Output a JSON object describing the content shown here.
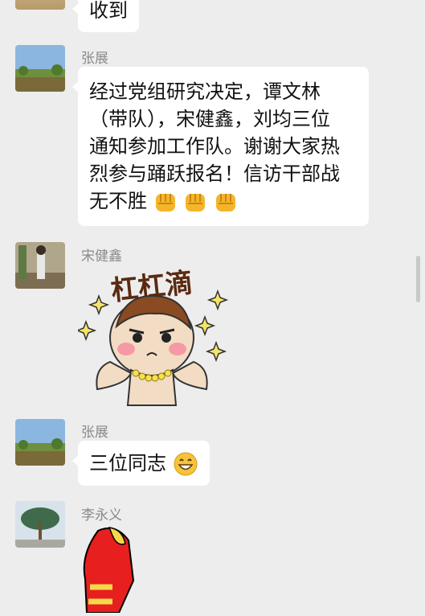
{
  "messages": [
    {
      "sender": "",
      "text": "收到"
    },
    {
      "sender": "张展",
      "lines": [
        "经过党组研究决定，谭文林",
        "（带队），宋健鑫，刘均三位",
        "通知参加工作队。谢谢大家热",
        "烈参与踊跃报名！信访干部战",
        "无不胜"
      ],
      "emoji": "fist-emoji"
    },
    {
      "sender": "宋健鑫",
      "sticker_text": "杠杠滴"
    },
    {
      "sender": "张展",
      "text": "三位同志",
      "emoji": "grin-emoji"
    },
    {
      "sender": "李永义",
      "sticker": "thumbs-up-sticker"
    }
  ],
  "colors": {
    "bubble": "#ffffff",
    "background": "#ededed",
    "name": "#8a8a8a"
  }
}
